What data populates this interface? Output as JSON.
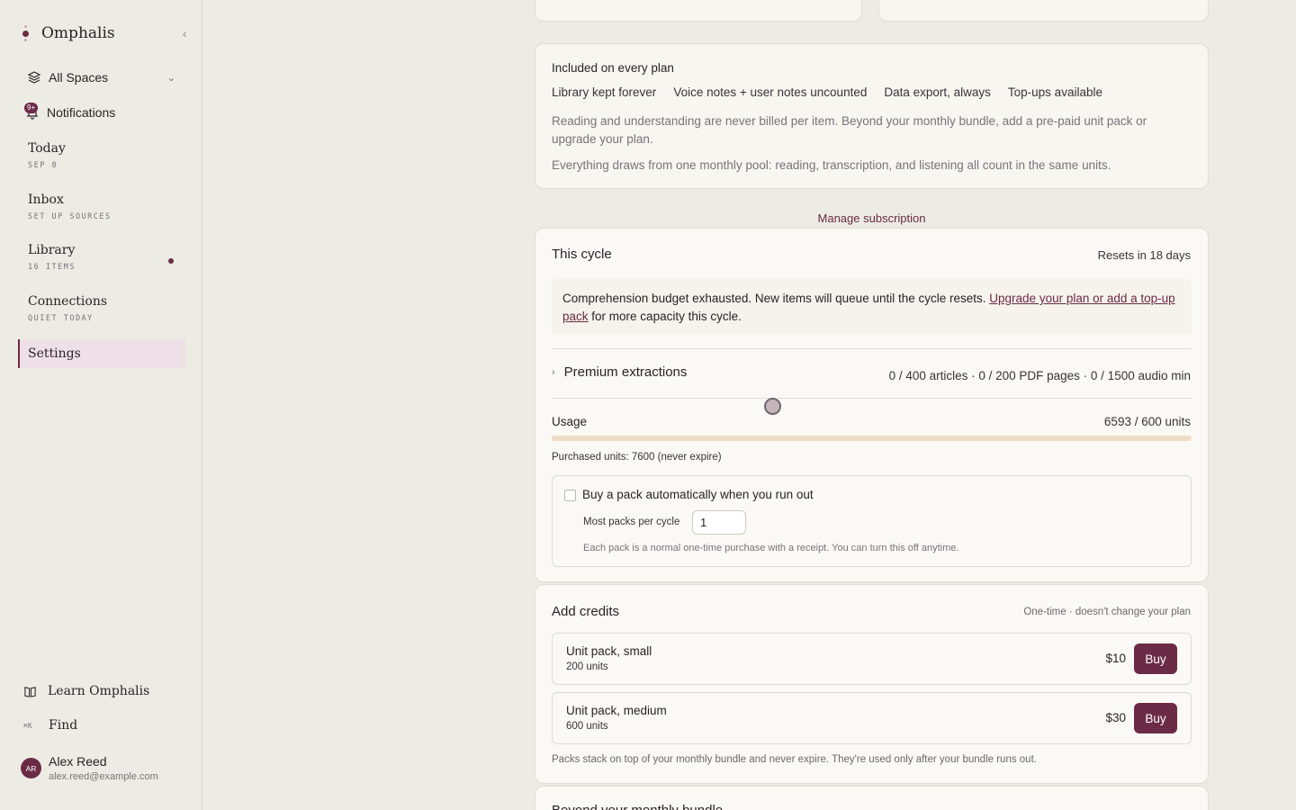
{
  "sidebar": {
    "brand": "Omphalis",
    "spaces_label": "All Spaces",
    "notifications": {
      "label": "Notifications",
      "badge": "9+"
    },
    "nav": [
      {
        "title": "Today",
        "sub": "SEP 8"
      },
      {
        "title": "Inbox",
        "sub": "SET UP SOURCES"
      },
      {
        "title": "Library",
        "sub": "16 ITEMS"
      },
      {
        "title": "Connections",
        "sub": "QUIET TODAY"
      },
      {
        "title": "Settings",
        "sub": ""
      }
    ],
    "learn": "Learn Omphalis",
    "find": {
      "label": "Find",
      "shortcut": "⌘K"
    },
    "user": {
      "initials": "AR",
      "name": "Alex Reed",
      "email": "alex.reed@example.com"
    }
  },
  "included": {
    "title": "Included on every plan",
    "features": [
      "Library kept forever",
      "Voice notes + user notes uncounted",
      "Data export, always",
      "Top-ups available"
    ],
    "p1": "Reading and understanding are never billed per item. Beyond your monthly bundle, add a pre-paid unit pack or upgrade your plan.",
    "p2": "Everything draws from one monthly pool: reading, transcription, and listening all count in the same units."
  },
  "manage_link": "Manage subscription",
  "cycle": {
    "title": "This cycle",
    "resets": "Resets in 18 days",
    "alert_text": "Comprehension budget exhausted. New items will queue until the cycle resets.",
    "alert_link": "Upgrade your plan or add a top-up pack",
    "alert_tail": "for more capacity this cycle.",
    "premium_label": "Premium extractions",
    "premium_stats": "0 / 400 articles · 0 / 200 PDF pages · 0 / 1500 audio min",
    "usage_label": "Usage",
    "usage_value": "6593 / 600 units",
    "usage_fraction": 1.0,
    "purchased": "Purchased units: 7600 (never expire)",
    "auto_label": "Buy a pack automatically when you run out",
    "most_label": "Most packs per cycle",
    "most_value": "1",
    "auto_note": "Each pack is a normal one-time purchase with a receipt. You can turn this off anytime."
  },
  "credits": {
    "title": "Add credits",
    "subtitle": "One-time · doesn't change your plan",
    "packs": [
      {
        "name": "Unit pack, small",
        "units": "200 units",
        "price": "$10",
        "buy": "Buy"
      },
      {
        "name": "Unit pack, medium",
        "units": "600 units",
        "price": "$30",
        "buy": "Buy"
      }
    ],
    "note": "Packs stack on top of your monthly bundle and never expire. They're used only after your bundle runs out."
  },
  "beyond_title": "Beyond your monthly bundle",
  "colors": {
    "accent": "#6b2a45",
    "background": "#ecebe4",
    "card": "#f7f6f1"
  }
}
